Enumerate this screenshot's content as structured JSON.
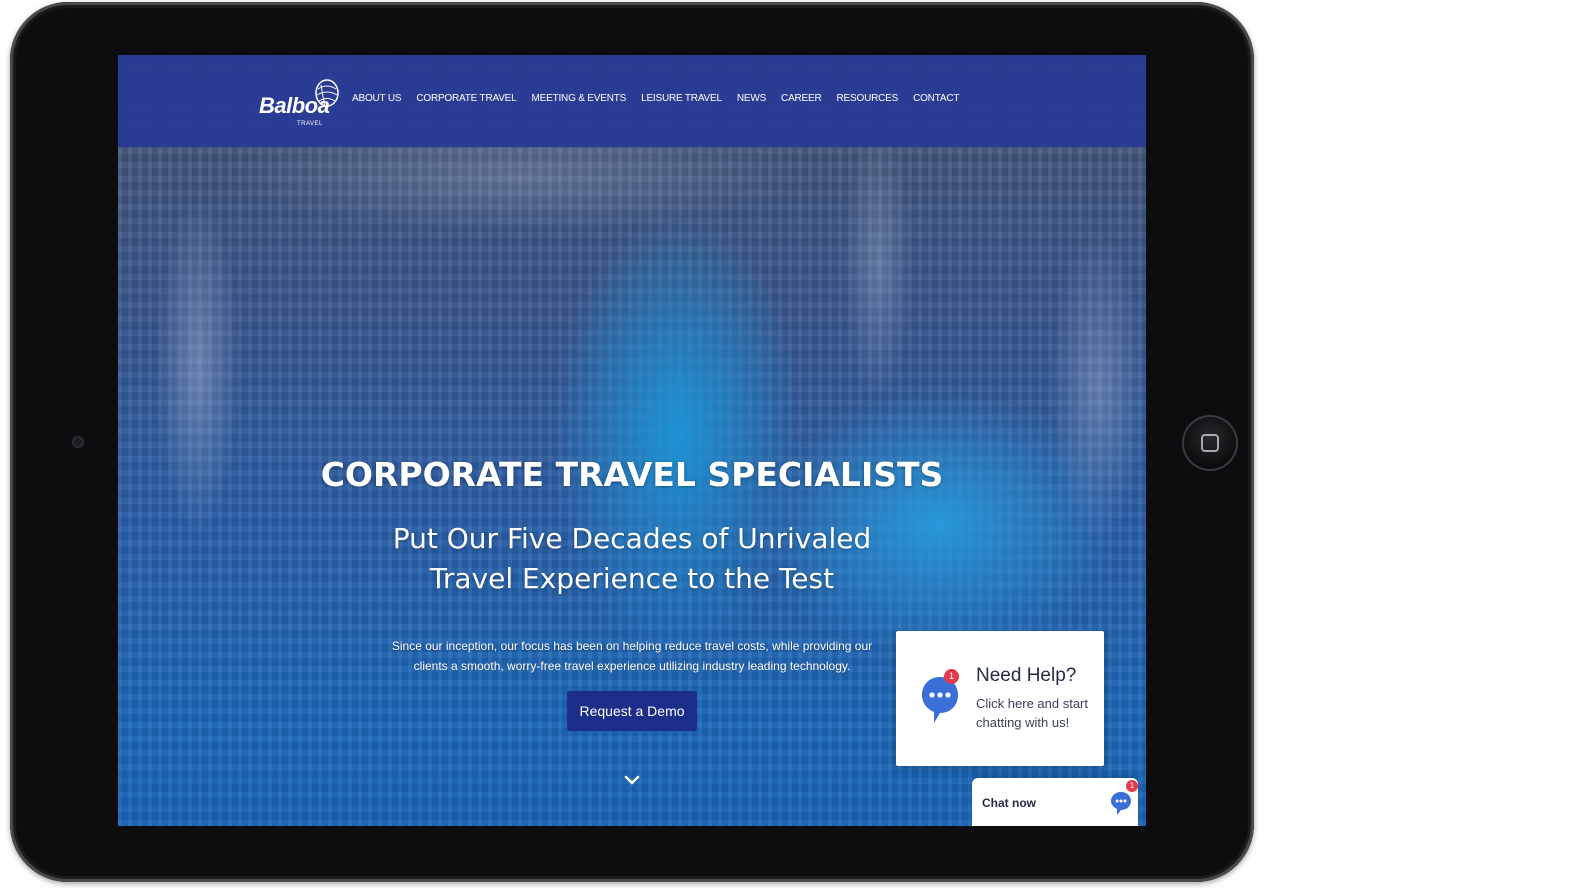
{
  "brand": {
    "name": "Balboa",
    "tagline": "TRAVEL"
  },
  "nav": {
    "items": [
      {
        "label": "ABOUT US"
      },
      {
        "label": "CORPORATE TRAVEL"
      },
      {
        "label": "MEETING & EVENTS"
      },
      {
        "label": "LEISURE TRAVEL"
      },
      {
        "label": "NEWS"
      },
      {
        "label": "CAREER"
      },
      {
        "label": "RESOURCES"
      },
      {
        "label": "CONTACT"
      }
    ]
  },
  "hero": {
    "title": "CORPORATE TRAVEL SPECIALISTS",
    "subtitle": "Put Our Five Decades of Unrivaled Travel Experience to the Test",
    "body": "Since our inception, our focus has been on helping reduce travel costs, while providing our clients a smooth, worry-free travel experience utilizing industry leading technology.",
    "cta_label": "Request a Demo"
  },
  "help_widget": {
    "title": "Need Help?",
    "text": "Click here and start chatting with us!",
    "badge_count": "1"
  },
  "chat_bar": {
    "label": "Chat now",
    "badge_count": "1"
  },
  "colors": {
    "nav_bg": "#283a96",
    "cta_bg": "#1d2d8a",
    "badge": "#e53950",
    "chat_icon": "#3b6fd8"
  }
}
